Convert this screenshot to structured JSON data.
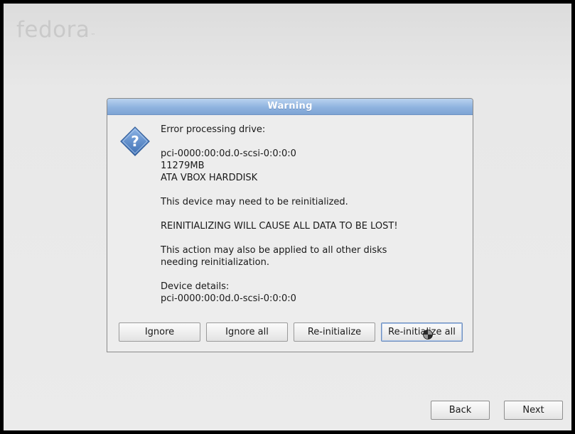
{
  "brand": {
    "logo_text": "fedora",
    "trademark": "™"
  },
  "dialog": {
    "title": "Warning",
    "icon": "question-icon",
    "message": {
      "intro": "Error processing drive:",
      "drive_path": "pci-0000:00:0d.0-scsi-0:0:0:0",
      "drive_size": "11279MB",
      "drive_model": "ATA VBOX HARDDISK",
      "reinit_notice": "This device may need to be reinitialized.",
      "data_loss_warning": "REINITIALIZING WILL CAUSE ALL DATA TO BE LOST!",
      "apply_all_line1": "This action may also be applied to all other disks",
      "apply_all_line2": "needing reinitialization.",
      "details_label": "Device details:",
      "details_value": "pci-0000:00:0d.0-scsi-0:0:0:0"
    },
    "buttons": {
      "ignore": "Ignore",
      "ignore_all": "Ignore all",
      "reinitialize": "Re-initialize",
      "reinitialize_all": "Re-initialize all"
    }
  },
  "navigation": {
    "back": "Back",
    "next": "Next"
  },
  "colors": {
    "titlebar": "#8fb3df",
    "icon": "#4a7cc0",
    "background": "#ebebeb"
  }
}
